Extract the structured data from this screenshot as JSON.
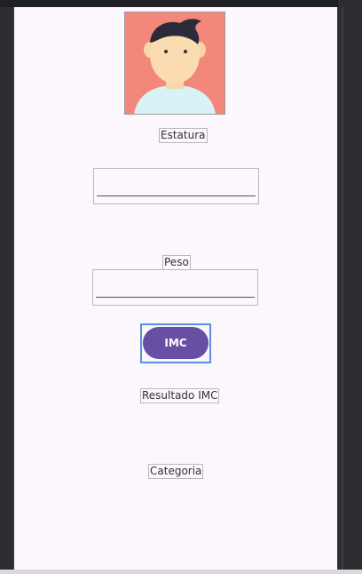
{
  "colors": {
    "screen_bg": "#fcf6fd",
    "avatar_bg": "#f4877b",
    "button_bg": "#6750a4",
    "focus_outline": "#5b8ee6"
  },
  "labels": {
    "height_label": "Estatura",
    "weight_label": "Peso",
    "result_label": "Resultado IMC",
    "category_label": "Categoria"
  },
  "inputs": {
    "height_value": "",
    "weight_value": ""
  },
  "button": {
    "imc_label": "IMC"
  },
  "icons": {
    "avatar": "person-avatar-icon"
  }
}
